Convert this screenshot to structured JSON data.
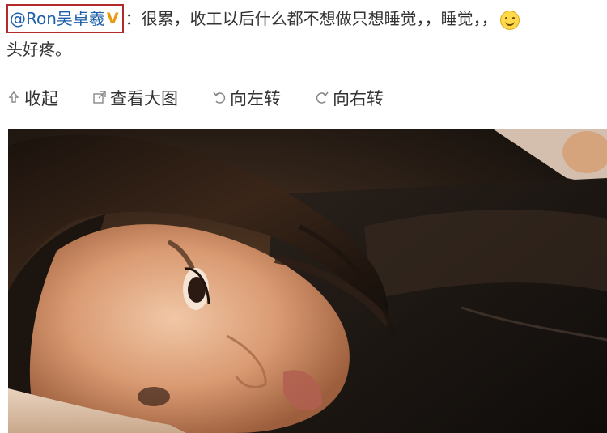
{
  "post": {
    "author": "@Ron吴卓羲",
    "badge_glyph": "V",
    "colon": "：",
    "text_line1": "很累，收工以后什么都不想做只想睡觉，，睡觉，，",
    "text_line2": "头好疼。",
    "emoji_icon": "smiley-icon"
  },
  "toolbar": {
    "collapse_label": "收起",
    "collapse_icon": "collapse-arrow-icon",
    "view_large_label": "查看大图",
    "view_large_icon": "expand-image-icon",
    "rotate_left_label": "向左转",
    "rotate_left_icon": "rotate-left-icon",
    "rotate_right_label": "向右转",
    "rotate_right_icon": "rotate-right-icon"
  },
  "photo": {
    "subject": "woman-lying-on-pillow-photo"
  },
  "colors": {
    "link_blue": "#1d5fa8",
    "highlight_border": "#b22a2a",
    "badge_orange": "#e89a12"
  }
}
